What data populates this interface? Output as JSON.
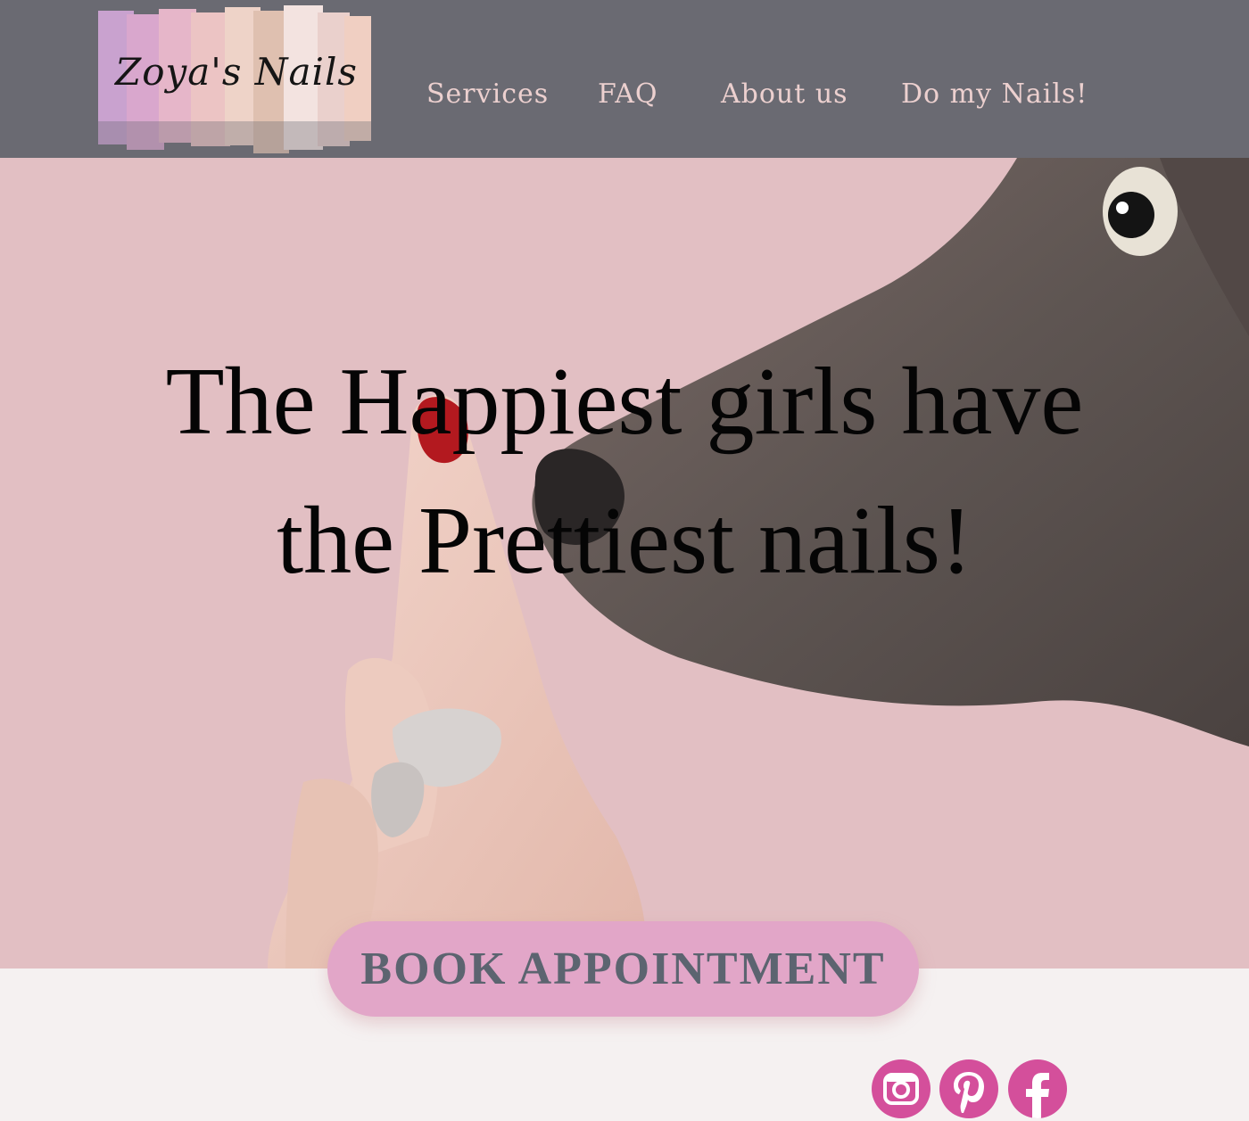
{
  "header": {
    "logo_text": "Zoya's Nails",
    "nav": [
      {
        "label": "Services"
      },
      {
        "label": "FAQ"
      },
      {
        "label": "About us"
      },
      {
        "label": "Do my Nails!"
      }
    ]
  },
  "hero": {
    "headline_line1": "The Happiest girls have",
    "headline_line2": "the Prettiest nails!",
    "cta_label": "BOOK APPOINTMENT"
  },
  "social": [
    {
      "icon": "instagram-icon"
    },
    {
      "icon": "pinterest-icon"
    },
    {
      "icon": "facebook-icon"
    }
  ],
  "colors": {
    "header_bg": "#6a6a72",
    "nav_text": "#ecd0cf",
    "hero_bg": "#e2bfc3",
    "cta_bg": "#e2a6c8",
    "cta_text": "#5c6470",
    "social_bg": "#d44f9b",
    "band_bg": "#f5f1f1"
  }
}
